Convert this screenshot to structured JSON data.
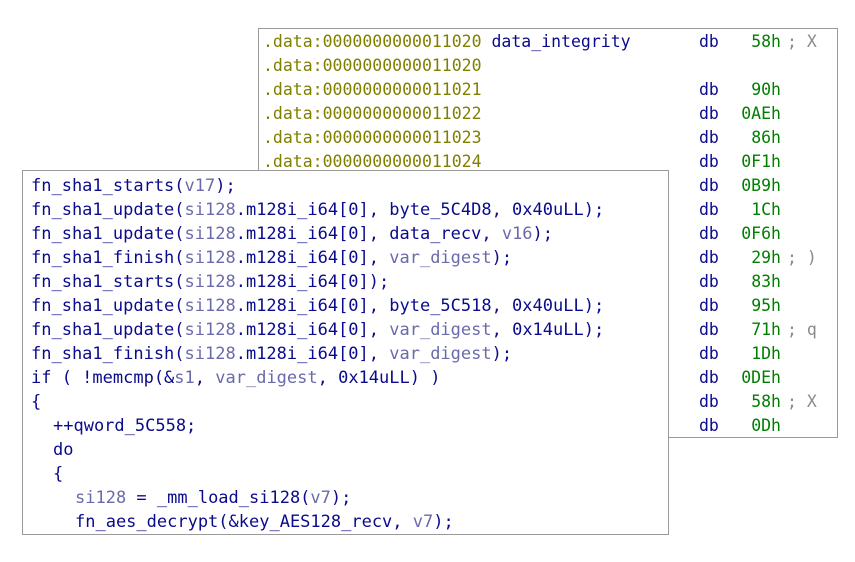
{
  "data_view": {
    "rows": [
      {
        "addr": ".data:0000000000011020",
        "name": "data_integrity",
        "db": "db",
        "val": "58h",
        "comment": "; X"
      },
      {
        "addr": ".data:0000000000011020",
        "name": "",
        "db": "",
        "val": "",
        "comment": ""
      },
      {
        "addr": ".data:0000000000011021",
        "name": "",
        "db": "db",
        "val": "90h",
        "comment": ""
      },
      {
        "addr": ".data:0000000000011022",
        "name": "",
        "db": "db",
        "val": "0AEh",
        "comment": ""
      },
      {
        "addr": ".data:0000000000011023",
        "name": "",
        "db": "db",
        "val": "86h",
        "comment": ""
      },
      {
        "addr": ".data:0000000000011024",
        "name": "",
        "db": "db",
        "val": "0F1h",
        "comment": ""
      },
      {
        "addr": "",
        "name": "",
        "db": "db",
        "val": "0B9h",
        "comment": ""
      },
      {
        "addr": "",
        "name": "",
        "db": "db",
        "val": "1Ch",
        "comment": ""
      },
      {
        "addr": "",
        "name": "",
        "db": "db",
        "val": "0F6h",
        "comment": ""
      },
      {
        "addr": "",
        "name": "",
        "db": "db",
        "val": "29h",
        "comment": "; )"
      },
      {
        "addr": "",
        "name": "",
        "db": "db",
        "val": "83h",
        "comment": ""
      },
      {
        "addr": "",
        "name": "",
        "db": "db",
        "val": "95h",
        "comment": ""
      },
      {
        "addr": "",
        "name": "",
        "db": "db",
        "val": "71h",
        "comment": "; q"
      },
      {
        "addr": "",
        "name": "",
        "db": "db",
        "val": "1Dh",
        "comment": ""
      },
      {
        "addr": "",
        "name": "",
        "db": "db",
        "val": "0DEh",
        "comment": ""
      },
      {
        "addr": "",
        "name": "",
        "db": "db",
        "val": "58h",
        "comment": "; X"
      },
      {
        "addr": "",
        "name": "",
        "db": "db",
        "val": "0Dh",
        "comment": ""
      }
    ]
  },
  "code_view": {
    "lines": [
      {
        "indent": 0,
        "tokens": [
          {
            "t": "fn",
            "s": "fn_sha1_starts("
          },
          {
            "t": "var",
            "s": "v17"
          },
          {
            "t": "pl",
            "s": ");"
          }
        ]
      },
      {
        "indent": 0,
        "tokens": [
          {
            "t": "fn",
            "s": "fn_sha1_update("
          },
          {
            "t": "var",
            "s": "si128"
          },
          {
            "t": "pl",
            "s": ".m128i_i64[0], byte_5C4D8, 0x40uLL);"
          }
        ]
      },
      {
        "indent": 0,
        "tokens": [
          {
            "t": "fn",
            "s": "fn_sha1_update("
          },
          {
            "t": "var",
            "s": "si128"
          },
          {
            "t": "pl",
            "s": ".m128i_i64[0], data_recv, "
          },
          {
            "t": "var",
            "s": "v16"
          },
          {
            "t": "pl",
            "s": ");"
          }
        ]
      },
      {
        "indent": 0,
        "tokens": [
          {
            "t": "fn",
            "s": "fn_sha1_finish("
          },
          {
            "t": "var",
            "s": "si128"
          },
          {
            "t": "pl",
            "s": ".m128i_i64[0], "
          },
          {
            "t": "var",
            "s": "var_digest"
          },
          {
            "t": "pl",
            "s": ");"
          }
        ]
      },
      {
        "indent": 0,
        "tokens": [
          {
            "t": "fn",
            "s": "fn_sha1_starts("
          },
          {
            "t": "var",
            "s": "si128"
          },
          {
            "t": "pl",
            "s": ".m128i_i64[0]);"
          }
        ]
      },
      {
        "indent": 0,
        "tokens": [
          {
            "t": "fn",
            "s": "fn_sha1_update("
          },
          {
            "t": "var",
            "s": "si128"
          },
          {
            "t": "pl",
            "s": ".m128i_i64[0], byte_5C518, 0x40uLL);"
          }
        ]
      },
      {
        "indent": 0,
        "tokens": [
          {
            "t": "fn",
            "s": "fn_sha1_update("
          },
          {
            "t": "var",
            "s": "si128"
          },
          {
            "t": "pl",
            "s": ".m128i_i64[0], "
          },
          {
            "t": "var",
            "s": "var_digest"
          },
          {
            "t": "pl",
            "s": ", 0x14uLL);"
          }
        ]
      },
      {
        "indent": 0,
        "tokens": [
          {
            "t": "fn",
            "s": "fn_sha1_finish("
          },
          {
            "t": "var",
            "s": "si128"
          },
          {
            "t": "pl",
            "s": ".m128i_i64[0], "
          },
          {
            "t": "var",
            "s": "var_digest"
          },
          {
            "t": "pl",
            "s": ");"
          }
        ]
      },
      {
        "indent": 0,
        "tokens": [
          {
            "t": "pl",
            "s": "if ( !memcmp(&"
          },
          {
            "t": "var",
            "s": "s1"
          },
          {
            "t": "pl",
            "s": ", "
          },
          {
            "t": "var",
            "s": "var_digest"
          },
          {
            "t": "pl",
            "s": ", 0x14uLL) )"
          }
        ]
      },
      {
        "indent": 0,
        "tokens": [
          {
            "t": "pl",
            "s": "{"
          }
        ]
      },
      {
        "indent": 1,
        "tokens": [
          {
            "t": "pl",
            "s": "++qword_5C558;"
          }
        ]
      },
      {
        "indent": 1,
        "tokens": [
          {
            "t": "pl",
            "s": "do"
          }
        ]
      },
      {
        "indent": 1,
        "tokens": [
          {
            "t": "pl",
            "s": "{"
          }
        ]
      },
      {
        "indent": 2,
        "tokens": [
          {
            "t": "var",
            "s": "si128"
          },
          {
            "t": "pl",
            "s": " = _mm_load_si128("
          },
          {
            "t": "var",
            "s": "v7"
          },
          {
            "t": "pl",
            "s": ");"
          }
        ]
      },
      {
        "indent": 2,
        "tokens": [
          {
            "t": "fn",
            "s": "fn_aes_decrypt("
          },
          {
            "t": "pl",
            "s": "&key_AES128_recv, "
          },
          {
            "t": "var",
            "s": "v7"
          },
          {
            "t": "pl",
            "s": ");"
          }
        ]
      }
    ]
  }
}
